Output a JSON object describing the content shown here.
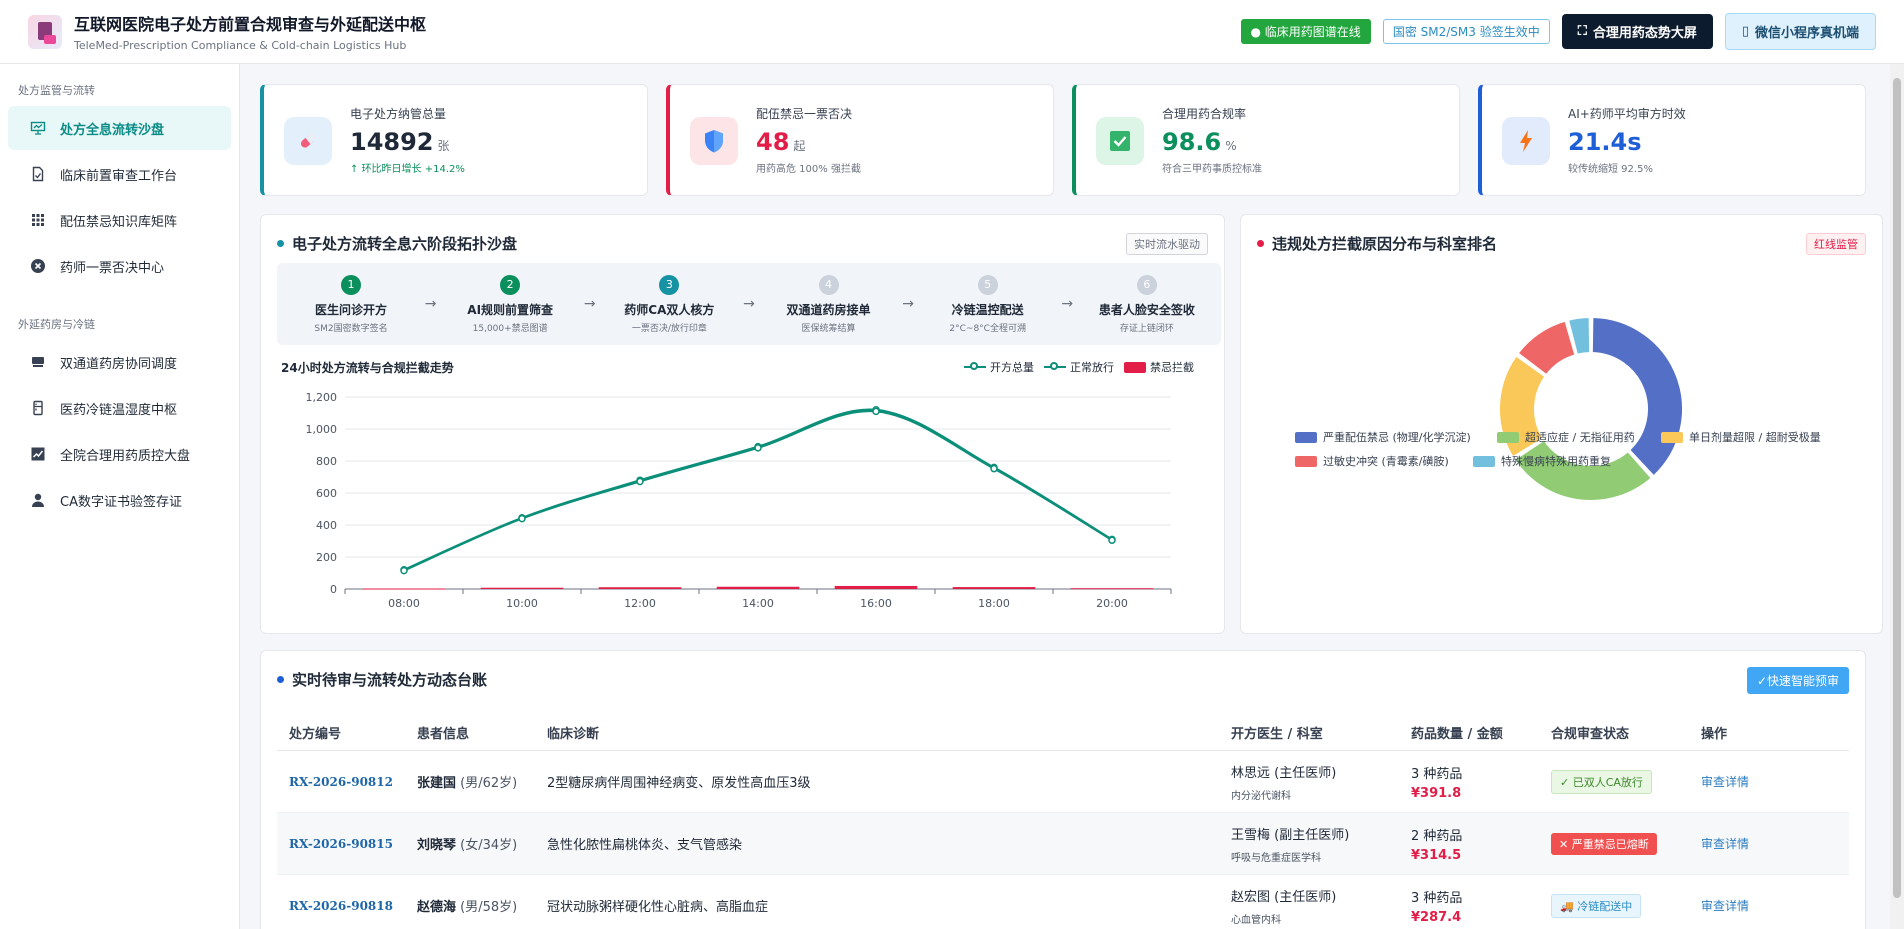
{
  "header": {
    "title": "互联网医院电子处方前置合规审查与外延配送中枢",
    "subtitle": "TeleMed-Prescription Compliance & Cold-chain Logistics Hub",
    "status_online": "● 临床用药图谱在线",
    "status_sign": "国密 SM2/SM3 验签生效中",
    "btn_dashboard": "合理用药态势大屏",
    "btn_miniapp": "微信小程序真机端"
  },
  "sidebar": {
    "group1": "处方监管与流转",
    "group2": "外延药房与冷链",
    "items": [
      {
        "label": "处方全息流转沙盘",
        "icon": "presentation-icon"
      },
      {
        "label": "临床前置审查工作台",
        "icon": "document-check-icon"
      },
      {
        "label": "配伍禁忌知识库矩阵",
        "icon": "grid-icon"
      },
      {
        "label": "药师一票否决中心",
        "icon": "cross-circle-icon"
      },
      {
        "label": "双通道药房协同调度",
        "icon": "pill-tray-icon"
      },
      {
        "label": "医药冷链温湿度中枢",
        "icon": "fridge-icon"
      },
      {
        "label": "全院合理用药质控大盘",
        "icon": "trend-chart-icon"
      },
      {
        "label": "CA数字证书验签存证",
        "icon": "user-certificate-icon"
      }
    ]
  },
  "kpis": [
    {
      "label": "电子处方纳管总量",
      "value": "14892",
      "unit": "张",
      "note": "↑ 环比昨日增长 +14.2%",
      "color": "#1592a3",
      "icon_bg": "#e3f0fb",
      "icon": "pill-icon"
    },
    {
      "label": "配伍禁忌一票否决",
      "value": "48",
      "unit": "起",
      "note": "用药高危 100% 强拦截",
      "color": "#e11d48",
      "icon_bg": "#fde4e6",
      "icon": "shield-icon"
    },
    {
      "label": "合理用药合规率",
      "value": "98.6",
      "unit": "%",
      "note": "符合三甲药事质控标准",
      "color": "#0b8f5c",
      "icon_bg": "#dcf5e6",
      "icon": "check-square-icon"
    },
    {
      "label": "AI+药师平均审方时效",
      "value": "21.4s",
      "unit": "",
      "note": "较传统缩短 92.5%",
      "color": "#1e5fd8",
      "icon_bg": "#e1ebfb",
      "icon": "lightning-icon"
    }
  ],
  "flow_panel": {
    "title": "电子处方流转全息六阶段拓扑沙盘",
    "tag": "实时流水驱动",
    "stages": [
      {
        "num": "1",
        "title": "医生问诊开方",
        "sub": "SM2国密数字签名",
        "color": "#0b8f5c"
      },
      {
        "num": "2",
        "title": "AI规则前置筛查",
        "sub": "15,000+禁忌图谱",
        "color": "#0b8f5c"
      },
      {
        "num": "3",
        "title": "药师CA双人核方",
        "sub": "一票否决/放行印章",
        "color": "#1592a3"
      },
      {
        "num": "4",
        "title": "双通道药房接单",
        "sub": "医保统筹结算",
        "color": "#cbd2dc"
      },
      {
        "num": "5",
        "title": "冷链温控配送",
        "sub": "2°C~8°C全程可溯",
        "color": "#cbd2dc"
      },
      {
        "num": "6",
        "title": "患者人脸安全签收",
        "sub": "存证上链闭环",
        "color": "#cbd2dc"
      }
    ],
    "arrow": "→"
  },
  "chart_data": {
    "type": "line",
    "title": "24小时处方流转与合规拦截走势",
    "categories": [
      "08:00",
      "10:00",
      "12:00",
      "14:00",
      "16:00",
      "18:00",
      "20:00"
    ],
    "ylim": [
      0,
      1200
    ],
    "yticks": [
      "0",
      "200",
      "400",
      "600",
      "800",
      "1,000",
      "1,200"
    ],
    "series": [
      {
        "name": "开方总量",
        "type": "line",
        "color": "#0b8f79",
        "values": [
          120,
          445,
          680,
          890,
          1120,
          760,
          310
        ]
      },
      {
        "name": "正常放行",
        "type": "line",
        "color": "#0b8f79",
        "values": [
          115,
          440,
          672,
          882,
          1110,
          752,
          305
        ]
      },
      {
        "name": "禁忌拦截",
        "type": "bar",
        "color": "#e11d48",
        "values": [
          3,
          8,
          11,
          14,
          19,
          12,
          5
        ]
      }
    ]
  },
  "pie_panel": {
    "title": "违规处方拦截原因分布与科室排名",
    "tag": "红线监管"
  },
  "pie_data": {
    "type": "pie",
    "slices": [
      {
        "name": "严重配伍禁忌 (物理/化学沉淀)",
        "value": 36,
        "color": "#5470c6"
      },
      {
        "name": "超适应症 / 无指征用药",
        "value": 26,
        "color": "#91cc75"
      },
      {
        "name": "单日剂量超限 / 超耐受极量",
        "value": 18,
        "color": "#fac858"
      },
      {
        "name": "过敏史冲突 (青霉素/磺胺)",
        "value": 10,
        "color": "#ee6666"
      },
      {
        "name": "特殊慢病特殊用药重复",
        "value": 4,
        "color": "#73c0de"
      }
    ]
  },
  "table": {
    "title": "实时待审与流转处方动态台账",
    "btn_review": "✓快速智能预审",
    "columns": [
      "处方编号",
      "患者信息",
      "临床诊断",
      "开方医生 / 科室",
      "药品数量 / 金额",
      "合规审查状态",
      "操作"
    ],
    "rows": [
      {
        "id": "RX-2026-90812",
        "name": "张建国",
        "meta": "(男/62岁)",
        "diag": "2型糖尿病伴周围神经病变、原发性高血压3级",
        "doctor": "林思远 (主任医师)",
        "dept": "内分泌代谢科",
        "qty": "3 种药品",
        "amount": "¥391.8",
        "status": "✓ 已双人CA放行",
        "status_type": "ok",
        "action": "审查详情"
      },
      {
        "id": "RX-2026-90815",
        "name": "刘晓琴",
        "meta": "(女/34岁)",
        "diag": "急性化脓性扁桃体炎、支气管感染",
        "doctor": "王雪梅 (副主任医师)",
        "dept": "呼吸与危重症医学科",
        "qty": "2 种药品",
        "amount": "¥314.5",
        "status": "✕ 严重禁忌已熔断",
        "status_type": "bad",
        "action": "审查详情"
      },
      {
        "id": "RX-2026-90818",
        "name": "赵德海",
        "meta": "(男/58岁)",
        "diag": "冠状动脉粥样硬化性心脏病、高脂血症",
        "doctor": "赵宏图 (主任医师)",
        "dept": "心血管内科",
        "qty": "3 种药品",
        "amount": "¥287.4",
        "status": "🚚 冷链配送中",
        "status_type": "cold",
        "action": "审查详情"
      }
    ]
  }
}
